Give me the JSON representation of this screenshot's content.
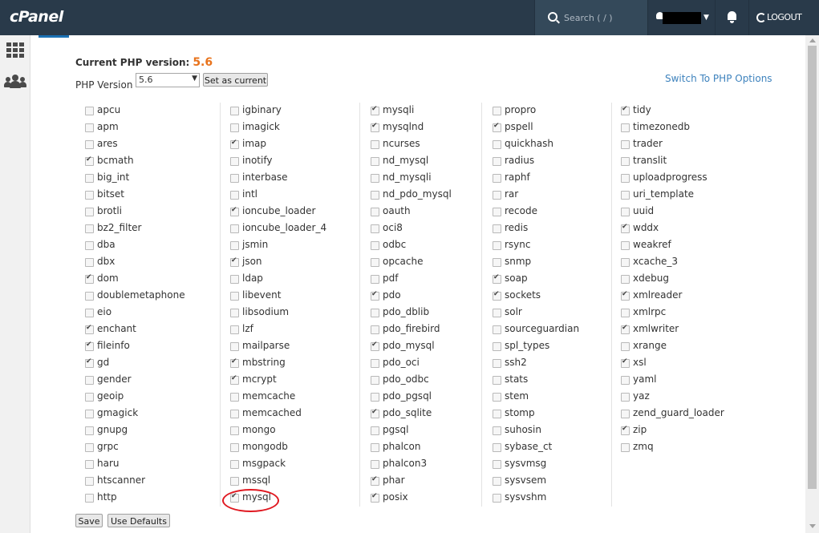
{
  "header": {
    "logo": "cPanel",
    "search_placeholder": "Search ( / )",
    "logout_label": "LOGOUT"
  },
  "php": {
    "current_label": "Current PHP version:",
    "current_version": "5.6",
    "version_label": "PHP Version",
    "selected_version": "5.6",
    "set_current_label": "Set as current",
    "switch_link": "Switch To PHP Options"
  },
  "extensions": [
    [
      {
        "name": "apcu",
        "checked": false
      },
      {
        "name": "apm",
        "checked": false
      },
      {
        "name": "ares",
        "checked": false
      },
      {
        "name": "bcmath",
        "checked": true
      },
      {
        "name": "big_int",
        "checked": false
      },
      {
        "name": "bitset",
        "checked": false
      },
      {
        "name": "brotli",
        "checked": false
      },
      {
        "name": "bz2_filter",
        "checked": false
      },
      {
        "name": "dba",
        "checked": false
      },
      {
        "name": "dbx",
        "checked": false
      },
      {
        "name": "dom",
        "checked": true
      },
      {
        "name": "doublemetaphone",
        "checked": false
      },
      {
        "name": "eio",
        "checked": false
      },
      {
        "name": "enchant",
        "checked": true
      },
      {
        "name": "fileinfo",
        "checked": true
      },
      {
        "name": "gd",
        "checked": true
      },
      {
        "name": "gender",
        "checked": false
      },
      {
        "name": "geoip",
        "checked": false
      },
      {
        "name": "gmagick",
        "checked": false
      },
      {
        "name": "gnupg",
        "checked": false
      },
      {
        "name": "grpc",
        "checked": false
      },
      {
        "name": "haru",
        "checked": false
      },
      {
        "name": "htscanner",
        "checked": false
      },
      {
        "name": "http",
        "checked": false
      }
    ],
    [
      {
        "name": "igbinary",
        "checked": false
      },
      {
        "name": "imagick",
        "checked": false
      },
      {
        "name": "imap",
        "checked": true
      },
      {
        "name": "inotify",
        "checked": false
      },
      {
        "name": "interbase",
        "checked": false
      },
      {
        "name": "intl",
        "checked": false
      },
      {
        "name": "ioncube_loader",
        "checked": true
      },
      {
        "name": "ioncube_loader_4",
        "checked": false
      },
      {
        "name": "jsmin",
        "checked": false
      },
      {
        "name": "json",
        "checked": true
      },
      {
        "name": "ldap",
        "checked": false
      },
      {
        "name": "libevent",
        "checked": false
      },
      {
        "name": "libsodium",
        "checked": false
      },
      {
        "name": "lzf",
        "checked": false
      },
      {
        "name": "mailparse",
        "checked": false
      },
      {
        "name": "mbstring",
        "checked": true
      },
      {
        "name": "mcrypt",
        "checked": true
      },
      {
        "name": "memcache",
        "checked": false
      },
      {
        "name": "memcached",
        "checked": false
      },
      {
        "name": "mongo",
        "checked": false
      },
      {
        "name": "mongodb",
        "checked": false
      },
      {
        "name": "msgpack",
        "checked": false
      },
      {
        "name": "mssql",
        "checked": false
      },
      {
        "name": "mysql",
        "checked": true
      }
    ],
    [
      {
        "name": "mysqli",
        "checked": true
      },
      {
        "name": "mysqlnd",
        "checked": true
      },
      {
        "name": "ncurses",
        "checked": false
      },
      {
        "name": "nd_mysql",
        "checked": false
      },
      {
        "name": "nd_mysqli",
        "checked": false
      },
      {
        "name": "nd_pdo_mysql",
        "checked": false
      },
      {
        "name": "oauth",
        "checked": false
      },
      {
        "name": "oci8",
        "checked": false
      },
      {
        "name": "odbc",
        "checked": false
      },
      {
        "name": "opcache",
        "checked": false
      },
      {
        "name": "pdf",
        "checked": false
      },
      {
        "name": "pdo",
        "checked": true
      },
      {
        "name": "pdo_dblib",
        "checked": false
      },
      {
        "name": "pdo_firebird",
        "checked": false
      },
      {
        "name": "pdo_mysql",
        "checked": true
      },
      {
        "name": "pdo_oci",
        "checked": false
      },
      {
        "name": "pdo_odbc",
        "checked": false
      },
      {
        "name": "pdo_pgsql",
        "checked": false
      },
      {
        "name": "pdo_sqlite",
        "checked": true
      },
      {
        "name": "pgsql",
        "checked": false
      },
      {
        "name": "phalcon",
        "checked": false
      },
      {
        "name": "phalcon3",
        "checked": false
      },
      {
        "name": "phar",
        "checked": true
      },
      {
        "name": "posix",
        "checked": true
      }
    ],
    [
      {
        "name": "propro",
        "checked": false
      },
      {
        "name": "pspell",
        "checked": true
      },
      {
        "name": "quickhash",
        "checked": false
      },
      {
        "name": "radius",
        "checked": false
      },
      {
        "name": "raphf",
        "checked": false
      },
      {
        "name": "rar",
        "checked": false
      },
      {
        "name": "recode",
        "checked": false
      },
      {
        "name": "redis",
        "checked": false
      },
      {
        "name": "rsync",
        "checked": false
      },
      {
        "name": "snmp",
        "checked": false
      },
      {
        "name": "soap",
        "checked": true
      },
      {
        "name": "sockets",
        "checked": true
      },
      {
        "name": "solr",
        "checked": false
      },
      {
        "name": "sourceguardian",
        "checked": false
      },
      {
        "name": "spl_types",
        "checked": false
      },
      {
        "name": "ssh2",
        "checked": false
      },
      {
        "name": "stats",
        "checked": false
      },
      {
        "name": "stem",
        "checked": false
      },
      {
        "name": "stomp",
        "checked": false
      },
      {
        "name": "suhosin",
        "checked": false
      },
      {
        "name": "sybase_ct",
        "checked": false
      },
      {
        "name": "sysvmsg",
        "checked": false
      },
      {
        "name": "sysvsem",
        "checked": false
      },
      {
        "name": "sysvshm",
        "checked": false
      }
    ],
    [
      {
        "name": "tidy",
        "checked": true
      },
      {
        "name": "timezonedb",
        "checked": false
      },
      {
        "name": "trader",
        "checked": false
      },
      {
        "name": "translit",
        "checked": false
      },
      {
        "name": "uploadprogress",
        "checked": false
      },
      {
        "name": "uri_template",
        "checked": false
      },
      {
        "name": "uuid",
        "checked": false
      },
      {
        "name": "wddx",
        "checked": true
      },
      {
        "name": "weakref",
        "checked": false
      },
      {
        "name": "xcache_3",
        "checked": false
      },
      {
        "name": "xdebug",
        "checked": false
      },
      {
        "name": "xmlreader",
        "checked": true
      },
      {
        "name": "xmlrpc",
        "checked": false
      },
      {
        "name": "xmlwriter",
        "checked": true
      },
      {
        "name": "xrange",
        "checked": false
      },
      {
        "name": "xsl",
        "checked": true
      },
      {
        "name": "yaml",
        "checked": false
      },
      {
        "name": "yaz",
        "checked": false
      },
      {
        "name": "zend_guard_loader",
        "checked": false
      },
      {
        "name": "zip",
        "checked": true
      },
      {
        "name": "zmq",
        "checked": false
      }
    ]
  ],
  "footer": {
    "save_label": "Save",
    "defaults_label": "Use Defaults"
  },
  "colors": {
    "topbar": "#293a4a",
    "version_accent": "#e8731c",
    "link": "#3d82bd",
    "highlight_circle": "#e01820"
  },
  "icons": [
    "search-icon",
    "user-icon",
    "chevron-down-icon",
    "bell-icon",
    "logout-icon",
    "grid-icon",
    "users-icon"
  ]
}
